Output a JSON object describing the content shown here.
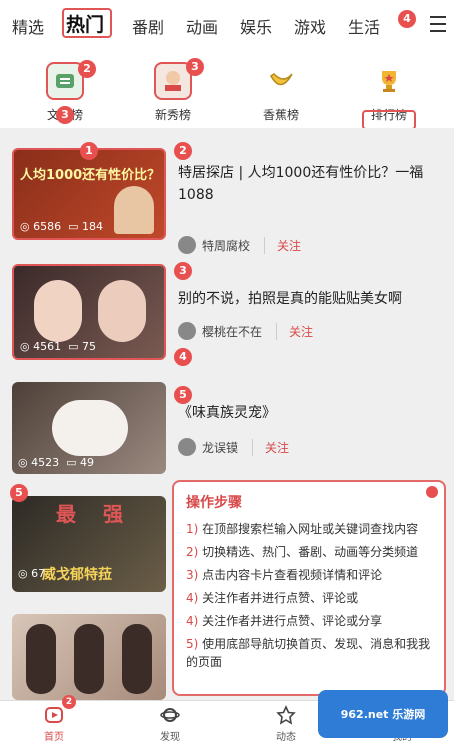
{
  "tabs": [
    {
      "label": "精选"
    },
    {
      "label": "热门"
    },
    {
      "label": "番剧"
    },
    {
      "label": "动画"
    },
    {
      "label": "娱乐"
    },
    {
      "label": "游戏"
    },
    {
      "label": "生活"
    }
  ],
  "categories": [
    {
      "label": "文学榜",
      "icon": "book-icon"
    },
    {
      "label": "新秀榜",
      "icon": "newcomer-icon"
    },
    {
      "label": "香蕉榜",
      "icon": "banana-icon"
    },
    {
      "label": "排行榜",
      "icon": "trophy-icon"
    }
  ],
  "badges": {
    "b1": "1",
    "b2": "2",
    "b3": "3",
    "b4": "4",
    "b5": "5"
  },
  "cards": [
    {
      "title": "特居探店 | 人均1000还有性价比？一福1088",
      "thumb_text": "人均1000还有性价比？",
      "views": "6586",
      "comments": "184",
      "author": "特周腐校",
      "follow": "关注",
      "color": "#7a2c1c"
    },
    {
      "title": "别的不说，拍照是真的能贴贴美女啊",
      "views": "4561",
      "comments": "75",
      "author": "樱桃在不在",
      "follow": "关注",
      "color": "#3a2a2a"
    },
    {
      "title": "《味真族灵宠》",
      "views": "4523",
      "comments": "49",
      "author": "龙误镆",
      "follow": "关注",
      "color": "#6b5a52"
    },
    {
      "title": "",
      "thumb_text": "最 强",
      "thumb_text2": "威戈郁特菈",
      "views": "67",
      "comments": "",
      "author": "",
      "follow": "",
      "color": "#3a3830"
    }
  ],
  "panel": {
    "title": "操作步骤",
    "steps": [
      {
        "num": "1)",
        "text": "在顶部搜索栏输入网址或关键词查找内容"
      },
      {
        "num": "2)",
        "text": "切换精选、热门、番剧、动画等分类频道"
      },
      {
        "num": "3)",
        "text": "点击内容卡片查看视频详情和评论"
      },
      {
        "num": "4)",
        "text": "关注作者并进行点赞、评论或"
      },
      {
        "num": "4)",
        "text": "关注作者并进行点赞、评论或分享"
      },
      {
        "num": "5)",
        "text": "使用底部导航切换首页、发现、消息和我我的页面"
      }
    ]
  },
  "bottomnav": [
    {
      "label": "首页",
      "icon": "home-icon"
    },
    {
      "label": "发现",
      "icon": "planet-icon"
    },
    {
      "label": "动态",
      "icon": "star-icon"
    },
    {
      "label": "我的",
      "icon": "user-icon"
    }
  ],
  "watermark": {
    "text": "962.net 乐游网"
  }
}
